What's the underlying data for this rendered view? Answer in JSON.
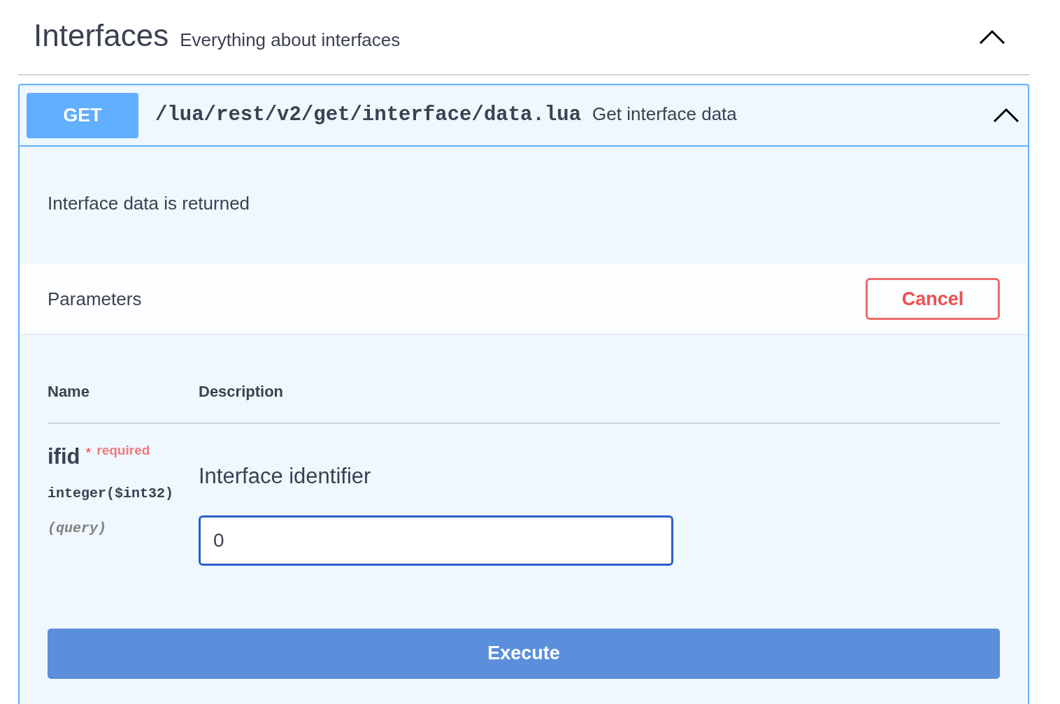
{
  "section": {
    "title": "Interfaces",
    "description": "Everything about interfaces",
    "expanded": true
  },
  "operation": {
    "method": "GET",
    "path": "/lua/rest/v2/get/interface/data.lua",
    "summary": "Get interface data",
    "expanded": true,
    "description": "Interface data is returned"
  },
  "parameters": {
    "title": "Parameters",
    "cancel_button": "Cancel",
    "columns": [
      "Name",
      "Description"
    ],
    "rows": [
      {
        "name": "ifid",
        "required_mark": "*",
        "required_label": "required",
        "type": "integer($int32)",
        "location": "(query)",
        "description": "Interface identifier",
        "value": "0"
      }
    ]
  },
  "execute_button": "Execute"
}
